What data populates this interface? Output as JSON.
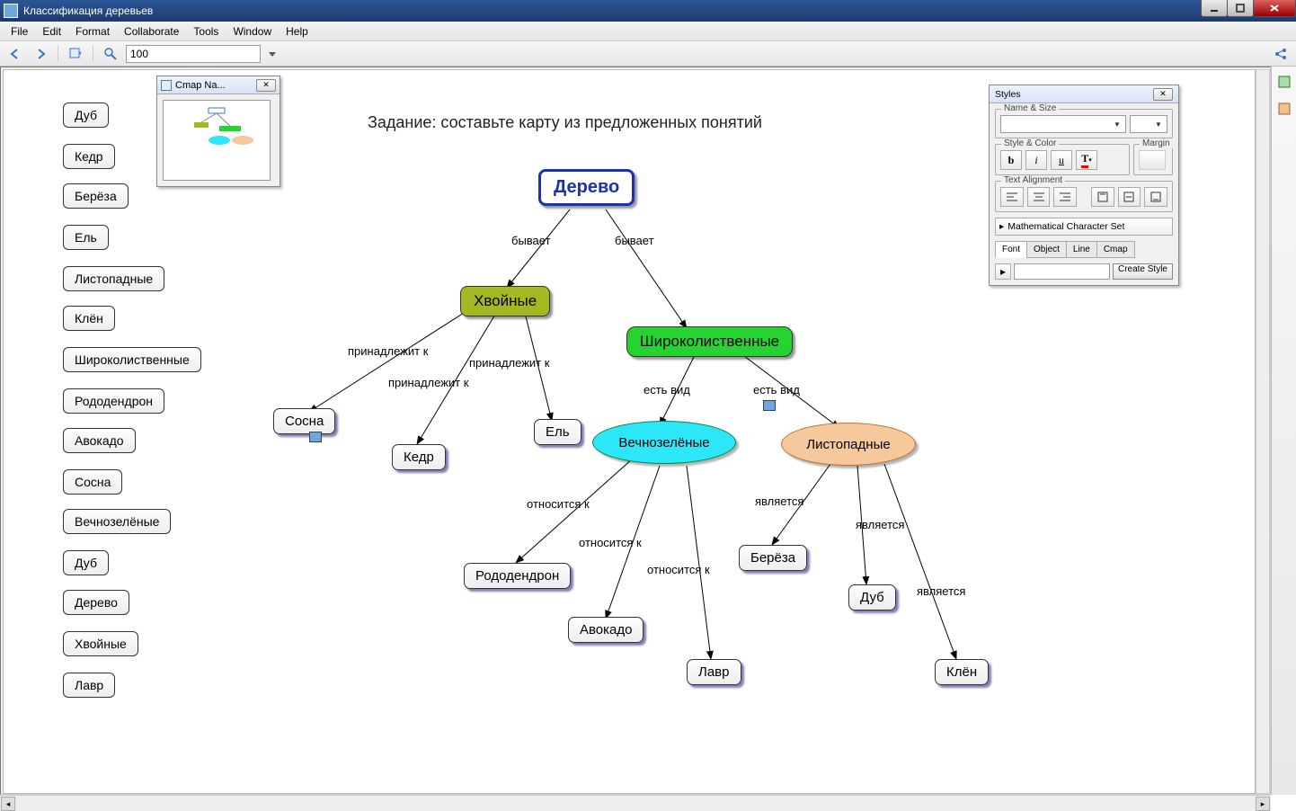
{
  "window": {
    "title": "Классификация деревьев"
  },
  "menu": [
    "File",
    "Edit",
    "Format",
    "Collaborate",
    "Tools",
    "Window",
    "Help"
  ],
  "toolbar": {
    "zoom": "100"
  },
  "mini_window": {
    "title": "Cmap Na..."
  },
  "task_title": "Задание: составьте карту из предложенных понятий",
  "pills": [
    "Дуб",
    "Кедр",
    "Берёза",
    "Ель",
    "Листопадные",
    "Клён",
    "Широколиственные",
    "Рододендрон",
    "Авокадо",
    "Сосна",
    "Вечнозелёные",
    "Дуб",
    "Дерево",
    "Хвойные",
    "Лавр"
  ],
  "nodes": {
    "root": "Дерево",
    "conifer": "Хвойные",
    "broadleaf": "Широколиственные",
    "evergreen": "Вечнозелёные",
    "deciduous": "Листопадные",
    "pine": "Сосна",
    "cedar": "Кедр",
    "fir": "Ель",
    "rhodo": "Рододендрон",
    "avocado": "Авокадо",
    "laurel": "Лавр",
    "birch": "Берёза",
    "oak": "Дуб",
    "maple": "Клён"
  },
  "links": {
    "byvaet": "бывает",
    "prinad": "принадлежит к",
    "est_vid": "есть вид",
    "otnos": "относится к",
    "yavl": "является"
  },
  "styles_panel": {
    "title": "Styles",
    "name_size": "Name & Size",
    "style_color": "Style & Color",
    "margin": "Margin",
    "text_align": "Text Alignment",
    "math": "Mathematical Character Set",
    "tabs": [
      "Font",
      "Object",
      "Line",
      "Cmap"
    ],
    "create": "Create Style"
  }
}
